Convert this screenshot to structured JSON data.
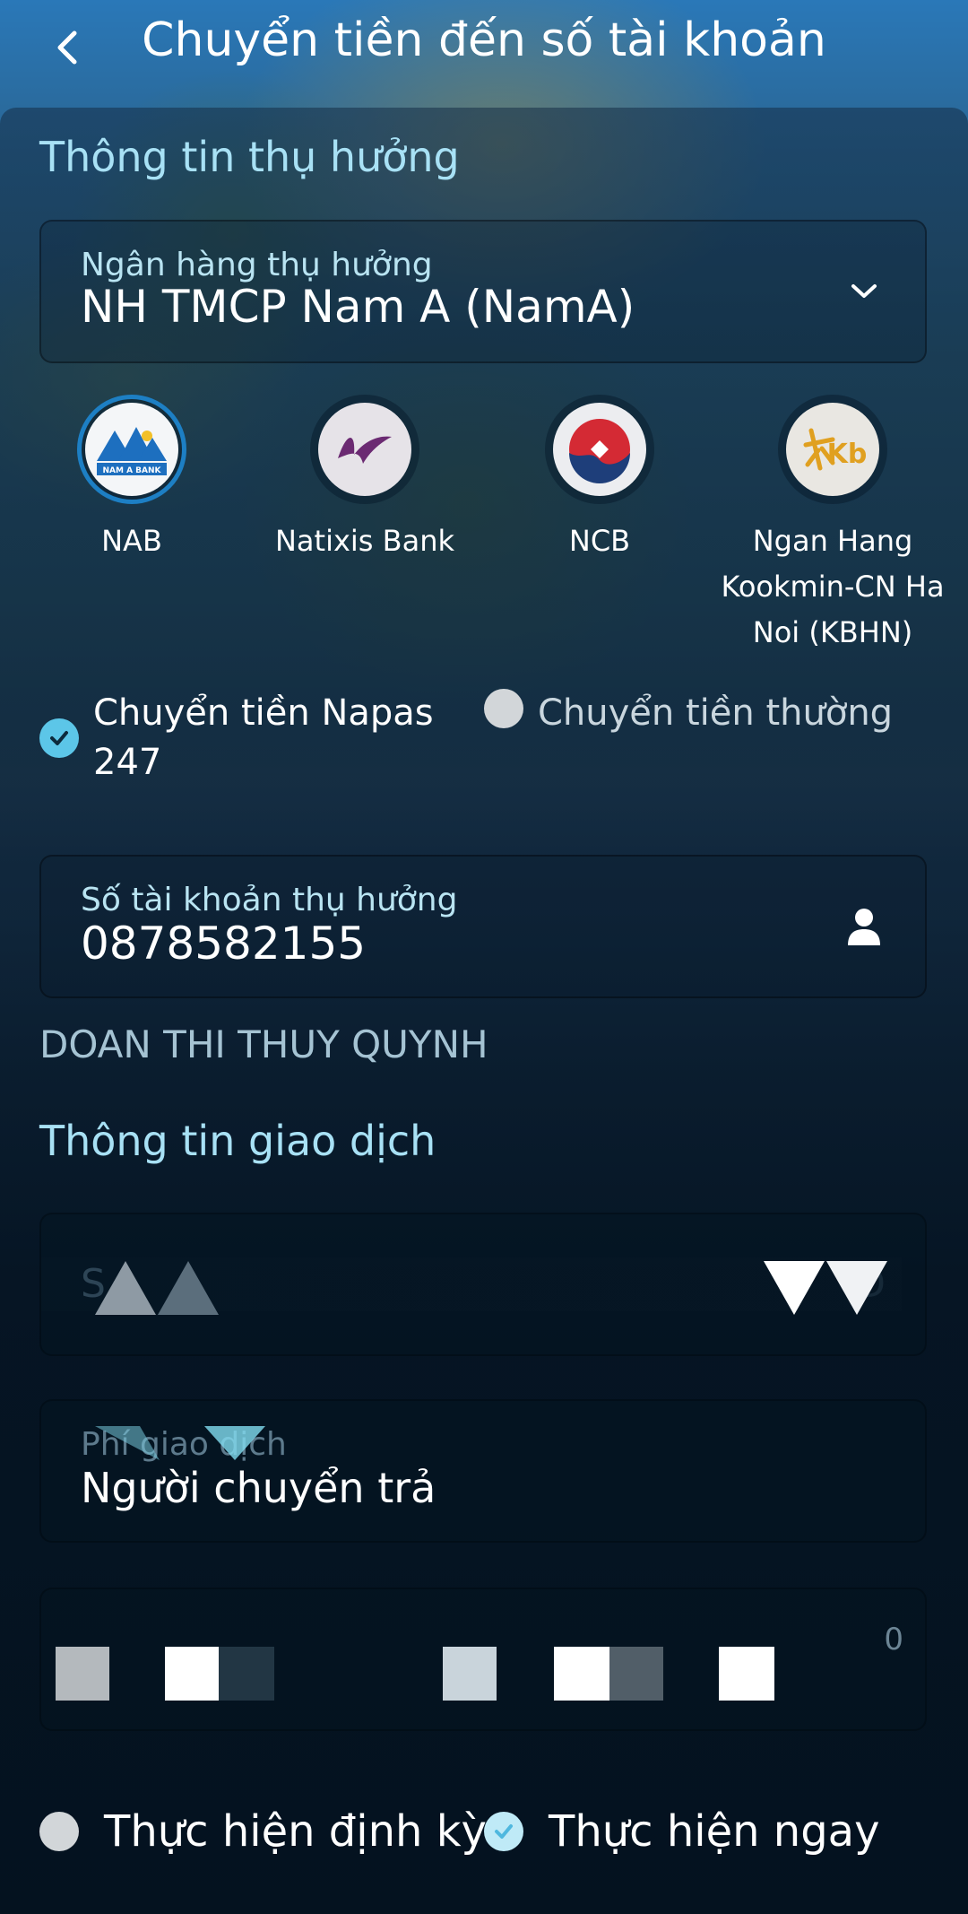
{
  "header": {
    "title": "Chuyển tiền đến số tài khoản",
    "back_icon": "chevron-left-icon"
  },
  "beneficiary_section": {
    "title": "Thông tin thụ hưởng",
    "bank_field": {
      "label": "Ngân hàng thụ hưởng",
      "value": "NH TMCP Nam A (NamA)",
      "icon": "chevron-down-icon"
    },
    "banks": [
      {
        "name": "NAB",
        "logo_text": "NAM A BANK",
        "selected": true
      },
      {
        "name": "Natixis Bank",
        "selected": false
      },
      {
        "name": "NCB",
        "selected": false
      },
      {
        "name": "Ngan Hang Kookmin-CN Ha Noi (KBHN)",
        "logo_text": "Kb",
        "selected": false
      }
    ],
    "transfer_types": [
      {
        "label": "Chuyển tiền Napas 247",
        "checked": true
      },
      {
        "label": "Chuyển tiền thường",
        "checked": false
      }
    ],
    "account_field": {
      "label": "Số tài khoản thụ hưởng",
      "value": "0878582155",
      "icon": "contact-person-icon"
    },
    "recipient_name": "DOAN THI THUY QUYNH"
  },
  "transaction_section": {
    "title": "Thông tin giao dịch",
    "amount_field": {
      "label_partial": "S",
      "suffix_partial": "D"
    },
    "fee_field": {
      "label": "Phí giao dịch",
      "value": "Người chuyển trả"
    },
    "content_field": {
      "counter_partial": "0"
    },
    "schedule_options": [
      {
        "label": "Thực hiện định kỳ",
        "checked": false
      },
      {
        "label": "Thực hiện ngay",
        "checked": true
      }
    ]
  },
  "colors": {
    "accent": "#a8e1f5",
    "selected_ring": "#1d7fc4",
    "radio_checked": "#5cc6e8",
    "radio_unchecked": "#d2d6d9"
  }
}
